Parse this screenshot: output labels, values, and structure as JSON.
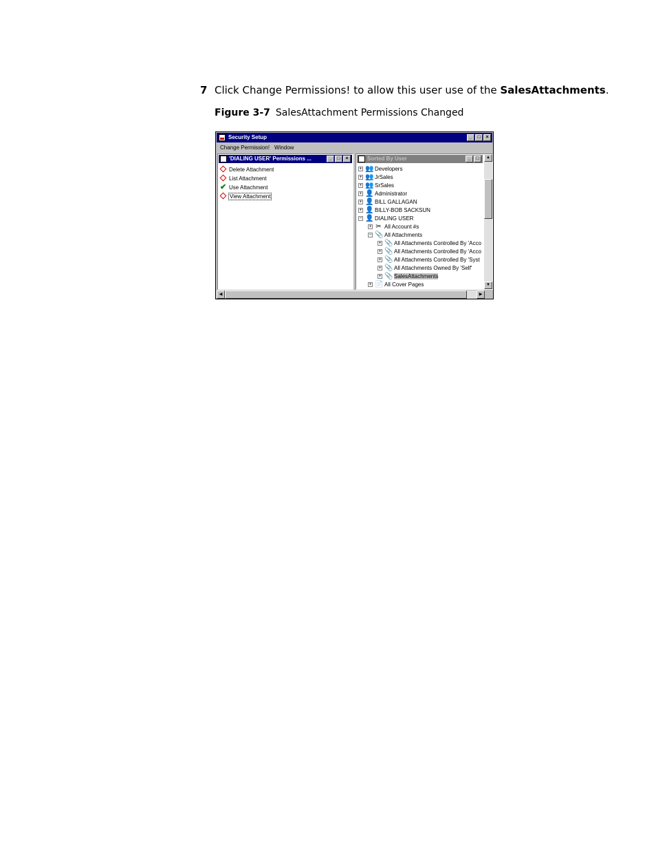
{
  "instruction": {
    "step_number": "7",
    "text_before": "Click Change Permissions! to allow this user use of the ",
    "bold_term": "SalesAttachments",
    "text_after": "."
  },
  "caption": {
    "figure_label": "Figure 3-7",
    "title": "SalesAttachment Permissions Changed"
  },
  "window": {
    "title": "Security Setup",
    "menu": [
      "Change Permission!",
      "Window"
    ],
    "controls": [
      "_",
      "□",
      "×"
    ]
  },
  "left_pane": {
    "title": "'DIALING USER' Permissions ...",
    "active": true,
    "permissions": [
      {
        "label": "Delete Attachment",
        "state": "denied"
      },
      {
        "label": "List Attachment",
        "state": "denied"
      },
      {
        "label": "Use Attachment",
        "state": "granted"
      },
      {
        "label": "View Attachment",
        "state": "denied",
        "focused": true
      }
    ]
  },
  "right_pane": {
    "title": "Sorted By User",
    "active": false,
    "tree": [
      {
        "label": "Developers",
        "expander": "+",
        "icon": "group-icon",
        "level": 0
      },
      {
        "label": "JrSales",
        "expander": "+",
        "icon": "group-icon",
        "level": 0
      },
      {
        "label": "SrSales",
        "expander": "+",
        "icon": "group-icon",
        "level": 0
      },
      {
        "label": "Administrator",
        "expander": "+",
        "icon": "user-icon",
        "level": 0
      },
      {
        "label": "BILL GALLAGAN",
        "expander": "+",
        "icon": "user-icon",
        "level": 0
      },
      {
        "label": "BILLY-BOB SACKSUN",
        "expander": "+",
        "icon": "user-icon",
        "level": 0
      },
      {
        "label": "DIALING USER",
        "expander": "−",
        "icon": "user-icon",
        "level": 0
      },
      {
        "label": "All Account #s",
        "expander": "+",
        "icon": "tools-icon",
        "level": 1
      },
      {
        "label": "All Attachments",
        "expander": "−",
        "icon": "attachment-icon",
        "level": 1
      },
      {
        "label": "All Attachments Controlled By 'Acco",
        "expander": "+",
        "icon": "attachment-icon",
        "level": 2
      },
      {
        "label": "All Attachments Controlled By 'Acco",
        "expander": "+",
        "icon": "attachment-icon",
        "level": 2
      },
      {
        "label": "All Attachments Controlled By 'Syst",
        "expander": "+",
        "icon": "attachment-icon",
        "level": 2
      },
      {
        "label": "All Attachments Owned By 'Self'",
        "expander": "+",
        "icon": "attachment-icon",
        "level": 2
      },
      {
        "label": "SalesAttachments",
        "expander": "+",
        "icon": "attachment-icon",
        "level": 2,
        "selected": true
      },
      {
        "label": "All Cover Pages",
        "expander": "+",
        "icon": "cover-page-icon",
        "level": 1
      }
    ]
  },
  "colors": {
    "active_title": "#000080",
    "inactive_title": "#808080",
    "denied": "#d00000",
    "granted": "#008000"
  }
}
